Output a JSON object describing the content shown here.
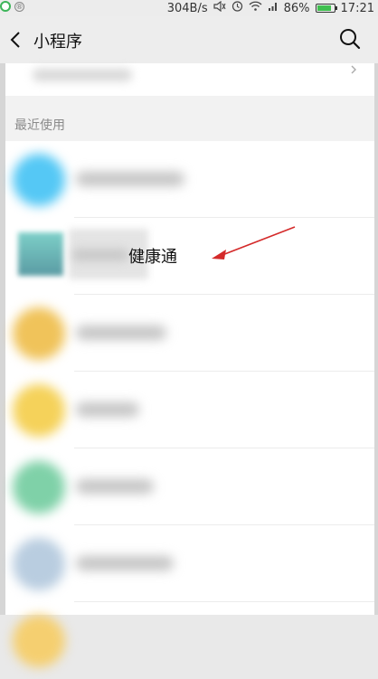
{
  "status_bar": {
    "network_speed": "304B/s",
    "battery_percent": "86%",
    "battery_level": 0.86,
    "time": "17:21",
    "icons": [
      "wechat-dot-icon",
      "registered-icon",
      "mute-icon",
      "alarm-icon",
      "wifi-icon",
      "signal-icon",
      "battery-icon"
    ]
  },
  "header": {
    "title": "小程序",
    "back_icon": "chevron-left-icon",
    "search_icon": "search-icon"
  },
  "section": {
    "title": "最近使用"
  },
  "recent_items": [
    {
      "label_visible": "",
      "icon_color": "#55c8f5"
    },
    {
      "label_visible": "健康通",
      "icon_color": "#6fbfbb"
    },
    {
      "label_visible": "",
      "icon_color": "#f0c35a"
    },
    {
      "label_visible": "",
      "icon_color": "#f5d25a"
    },
    {
      "label_visible": "",
      "icon_color": "#7fd1a8"
    },
    {
      "label_visible": "",
      "icon_color": "#b9cde0"
    },
    {
      "label_visible": "",
      "icon_color": "#f5cf70"
    }
  ],
  "colors": {
    "annotation_arrow": "#d42a2a",
    "background": "#e9e9e9",
    "list_background": "#ffffff"
  }
}
